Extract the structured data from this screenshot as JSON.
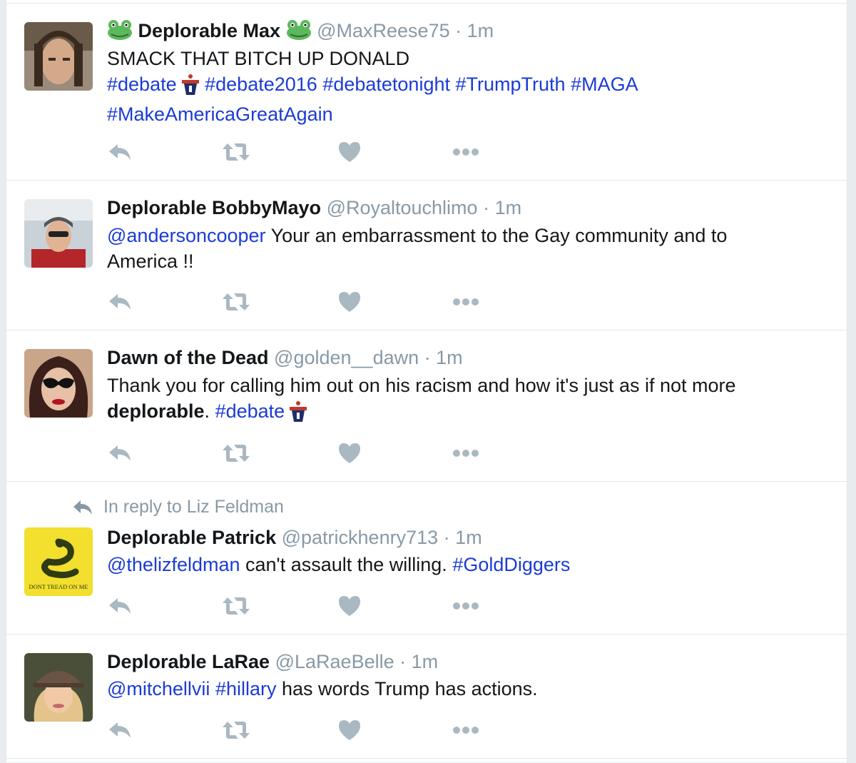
{
  "colors": {
    "link": "#1b3bd6",
    "meta": "#8899a6",
    "divider": "#e1e8ed",
    "action_icon": "#aab8c2"
  },
  "tweets": [
    {
      "name": "Deplorable Max",
      "handle": "@MaxReese75",
      "separator": "·",
      "time": "1m",
      "name_emoji": "frog-emoji",
      "text": "SMACK THAT BITCH UP DONALD",
      "hashtags_line1": [
        "#debate",
        "#debate2016",
        "#debatetonight",
        "#TrumpTruth",
        "#MAGA"
      ],
      "hashtags_line2": [
        "#MakeAmericaGreatAgain"
      ],
      "hashflag": "debate-podium-icon"
    },
    {
      "name": "Deplorable BobbyMayo",
      "handle": "@Royaltouchlimo",
      "separator": "·",
      "time": "1m",
      "mention": "@andersoncooper",
      "text_rest": " Your an embarrassment to the Gay community and to",
      "text_line2": "America !!"
    },
    {
      "name": "Dawn of the Dead",
      "handle": "@golden__dawn",
      "separator": "·",
      "time": "1m",
      "text_line1": "Thank you for calling him out on his racism and how it's just as if not more",
      "text_bold": "deplorable",
      "text_period": ".",
      "hashtag": "#debate",
      "hashflag": "debate-podium-icon"
    },
    {
      "in_reply_to": "In reply to Liz Feldman",
      "name": "Deplorable Patrick",
      "handle": "@patrickhenry713",
      "separator": "·",
      "time": "1m",
      "mention": "@thelizfeldman",
      "text_mid": " can't assault the willing. ",
      "hashtag": "#GoldDiggers",
      "avatar_text": "DONT TREAD ON ME"
    },
    {
      "name": "Deplorable LaRae",
      "handle": "@LaRaeBelle",
      "separator": "·",
      "time": "1m",
      "mention": "@mitchellvii",
      "hashtag": "#hillary",
      "text_rest": " has words Trump has actions."
    }
  ],
  "actions": [
    {
      "name": "reply",
      "icon": "reply-icon"
    },
    {
      "name": "retweet",
      "icon": "retweet-icon"
    },
    {
      "name": "like",
      "icon": "heart-icon"
    },
    {
      "name": "more",
      "icon": "more-icon"
    }
  ]
}
